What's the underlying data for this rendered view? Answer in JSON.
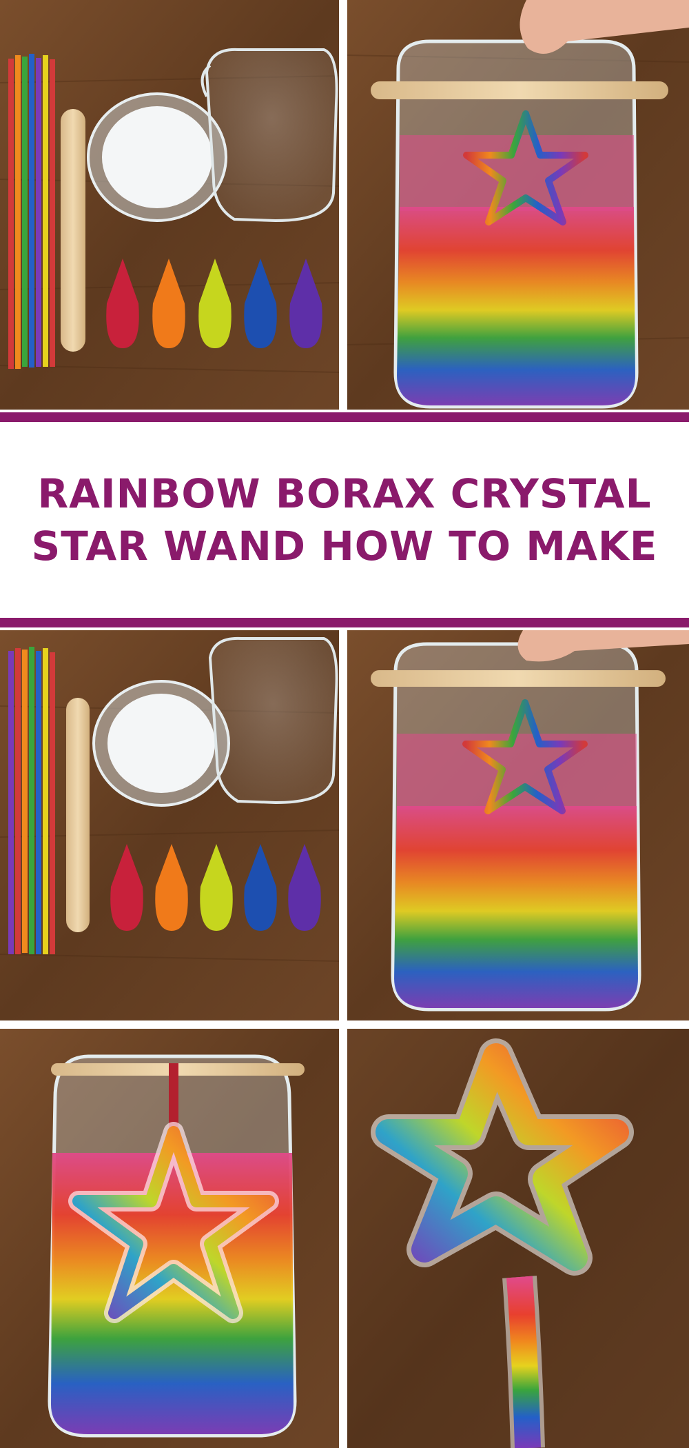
{
  "title": {
    "line1": "RAINBOW BORAX CRYSTAL",
    "line2": "STAR WAND HOW TO MAKE"
  },
  "colors": {
    "accent": "#8a1a6b",
    "wood": "#6b4426",
    "background": "#ffffff"
  },
  "panels": [
    {
      "name": "supplies-photo",
      "depicts": "pipe-cleaners-craft-stick-borax-water-dye-bottles"
    },
    {
      "name": "star-in-jar-photo",
      "depicts": "hand-hanging-pipe-cleaner-star-in-rainbow-jar"
    },
    {
      "name": "supplies-photo-2",
      "depicts": "pipe-cleaners-craft-stick-borax-water-dye-bottles"
    },
    {
      "name": "star-in-jar-photo-2",
      "depicts": "hand-hanging-pipe-cleaner-star-in-rainbow-jar"
    },
    {
      "name": "crystal-star-in-jar-photo",
      "depicts": "crystallized-star-in-rainbow-solution"
    },
    {
      "name": "finished-wand-photo",
      "depicts": "finished-rainbow-crystal-star-wand"
    }
  ]
}
